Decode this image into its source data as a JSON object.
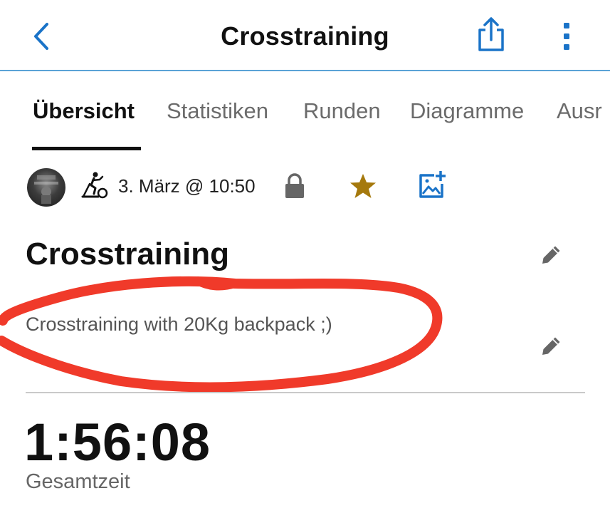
{
  "header": {
    "title": "Crosstraining",
    "back_icon": "chevron-left-icon",
    "share_icon": "share-icon",
    "more_icon": "more-vertical-icon",
    "accent_color": "#1a73c8"
  },
  "tabs": [
    {
      "label": "Übersicht",
      "active": true
    },
    {
      "label": "Statistiken",
      "active": false
    },
    {
      "label": "Runden",
      "active": false
    },
    {
      "label": "Diagramme",
      "active": false
    },
    {
      "label": "Ausr",
      "active": false
    }
  ],
  "meta": {
    "activity_type_icon": "elliptical-trainer-icon",
    "date": "3. März @ 10:50",
    "privacy_icon": "lock-icon",
    "favorite_icon": "star-icon",
    "favorite_color": "#a5790d",
    "add_photo_icon": "add-photo-icon"
  },
  "activity": {
    "title": "Crosstraining",
    "description": "Crosstraining with 20Kg backpack ;)",
    "edit_icon": "pencil-icon"
  },
  "annotation": {
    "color": "#f03a2a"
  },
  "stats": {
    "total_time": "1:56:08",
    "total_time_label": "Gesamtzeit"
  }
}
